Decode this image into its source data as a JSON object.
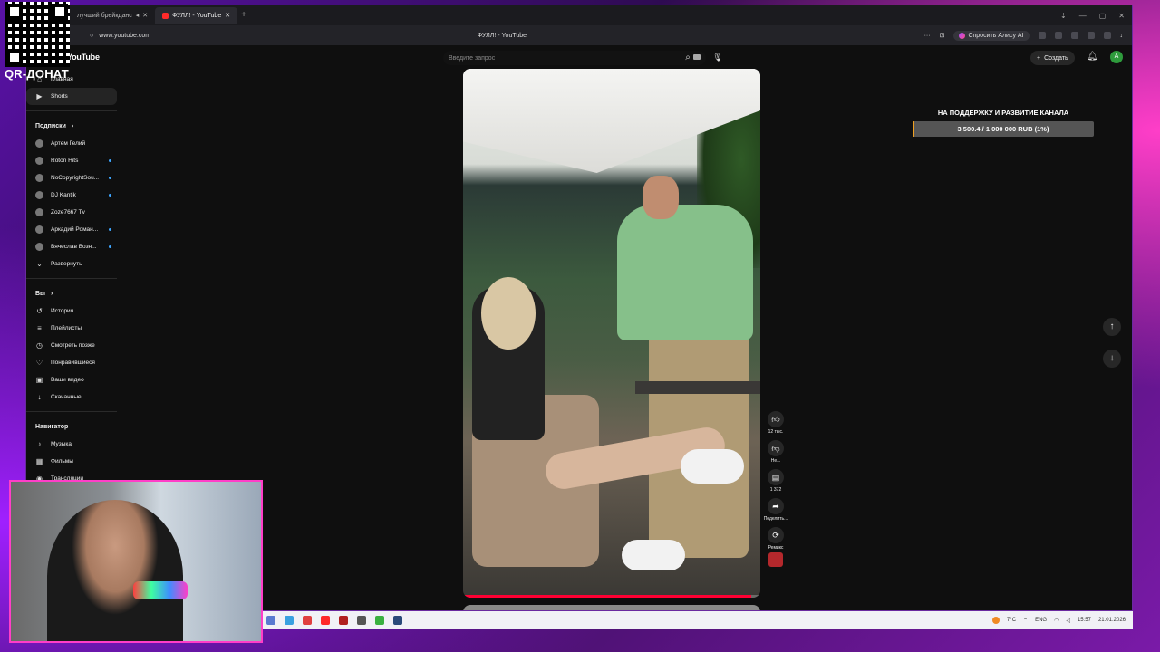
{
  "browser": {
    "tabs": [
      {
        "label": "лучший брейкданс",
        "active": false
      },
      {
        "label": "ФУЛЛ! - YouTube",
        "active": true
      }
    ],
    "url": "www.youtube.com",
    "page_title": "ФУЛЛ! - YouTube",
    "alice_label": "Спросить Алису AI"
  },
  "header": {
    "logo": "YouTube",
    "search_placeholder": "Введите запрос",
    "create_label": "Создать",
    "avatar_letter": "A"
  },
  "sidebar": {
    "top_items": [
      {
        "label": "Главная",
        "icon": "home-icon"
      },
      {
        "label": "Shorts",
        "icon": "shorts-icon",
        "active": true
      }
    ],
    "subscriptions_title": "Подписки",
    "subscriptions": [
      {
        "label": "Артем Гелий",
        "dot": false
      },
      {
        "label": "Roton Hits",
        "dot": true
      },
      {
        "label": "NoCopyrightSou...",
        "dot": true
      },
      {
        "label": "DJ Kantik",
        "dot": true
      },
      {
        "label": "Zoze7667 Tv",
        "dot": false
      },
      {
        "label": "Аркадий Роман...",
        "dot": true
      },
      {
        "label": "Вячеслав Возн...",
        "dot": true
      }
    ],
    "expand_label": "Развернуть",
    "you_title": "Вы",
    "you_items": [
      {
        "label": "История",
        "icon": "history-icon"
      },
      {
        "label": "Плейлисты",
        "icon": "playlist-icon"
      },
      {
        "label": "Смотреть позже",
        "icon": "clock-icon"
      },
      {
        "label": "Понравившиеся",
        "icon": "thumb-up-icon"
      },
      {
        "label": "Ваши видео",
        "icon": "video-icon"
      },
      {
        "label": "Скачанные",
        "icon": "download-icon"
      }
    ],
    "navigator_title": "Навигатор",
    "navigator_items": [
      {
        "label": "Музыка",
        "icon": "music-icon"
      },
      {
        "label": "Фильмы",
        "icon": "film-icon"
      },
      {
        "label": "Трансляции",
        "icon": "live-icon"
      }
    ]
  },
  "actions": {
    "likes": "12 тыс.",
    "dislike": "Не...",
    "comments": "1 372",
    "share": "Поделить...",
    "remix": "Ремикс"
  },
  "video": {
    "progress": 0.97
  },
  "donation": {
    "title": "НА ПОДДЕРЖКУ И РАЗВИТИЕ КАНАЛА",
    "text": "3 500.4 / 1 000 000 RUB (1%)",
    "progress": 0.01
  },
  "overlay": {
    "qr_label": "QR-ДОНАТ"
  },
  "taskbar": {
    "lang": "ENG",
    "weather": "7°C",
    "time": "15:57",
    "date": "21.01.2026"
  },
  "colors": {
    "accent": "#ff0033",
    "donation_fill": "#f0a020",
    "neon_frame": "#ff3ec8"
  }
}
